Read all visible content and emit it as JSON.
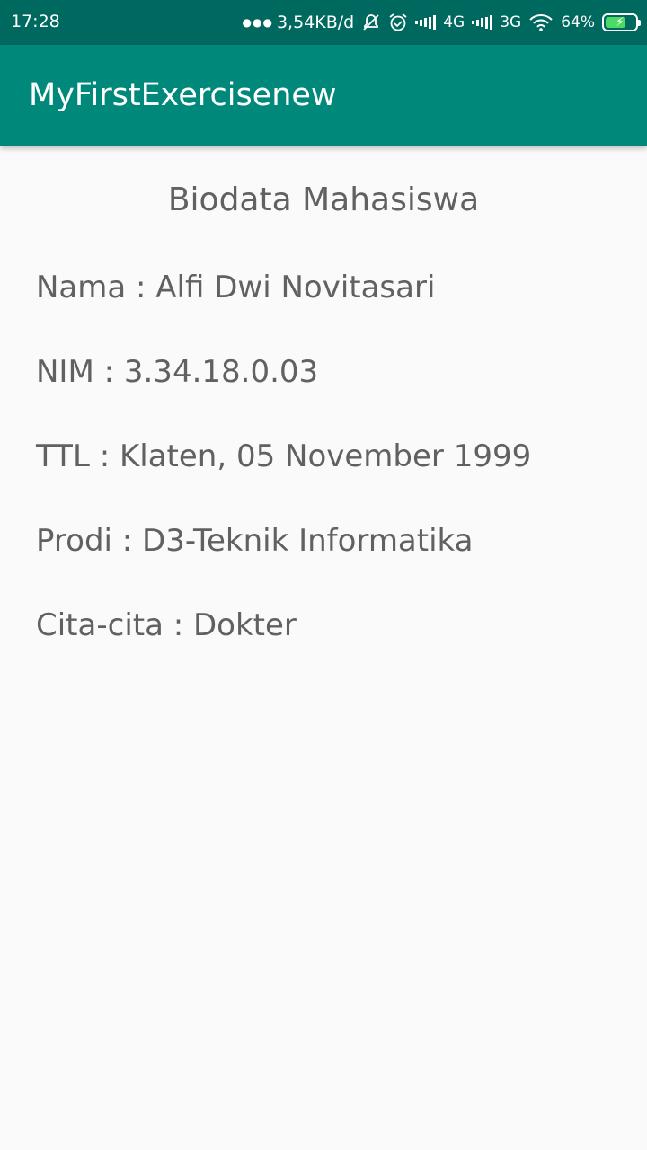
{
  "status_bar": {
    "time": "17:28",
    "speed": "3,54KB/d",
    "network_1": "4G",
    "network_2": "3G",
    "battery": "64%",
    "icons": [
      "dots-icon",
      "mute-bell-icon",
      "alarm-icon",
      "signal-icon",
      "wifi-icon",
      "battery-icon"
    ]
  },
  "app_bar": {
    "title": "MyFirstExercisenew",
    "color": "#00897b"
  },
  "main": {
    "heading": "Biodata Mahasiswa",
    "items": [
      {
        "label": "Nama : Alfi Dwi Novitasari"
      },
      {
        "label": "NIM : 3.34.18.0.03"
      },
      {
        "label": "TTL : Klaten, 05 November 1999"
      },
      {
        "label": "Prodi : D3-Teknik Informatika"
      },
      {
        "label": "Cita-cita : Dokter"
      }
    ]
  }
}
